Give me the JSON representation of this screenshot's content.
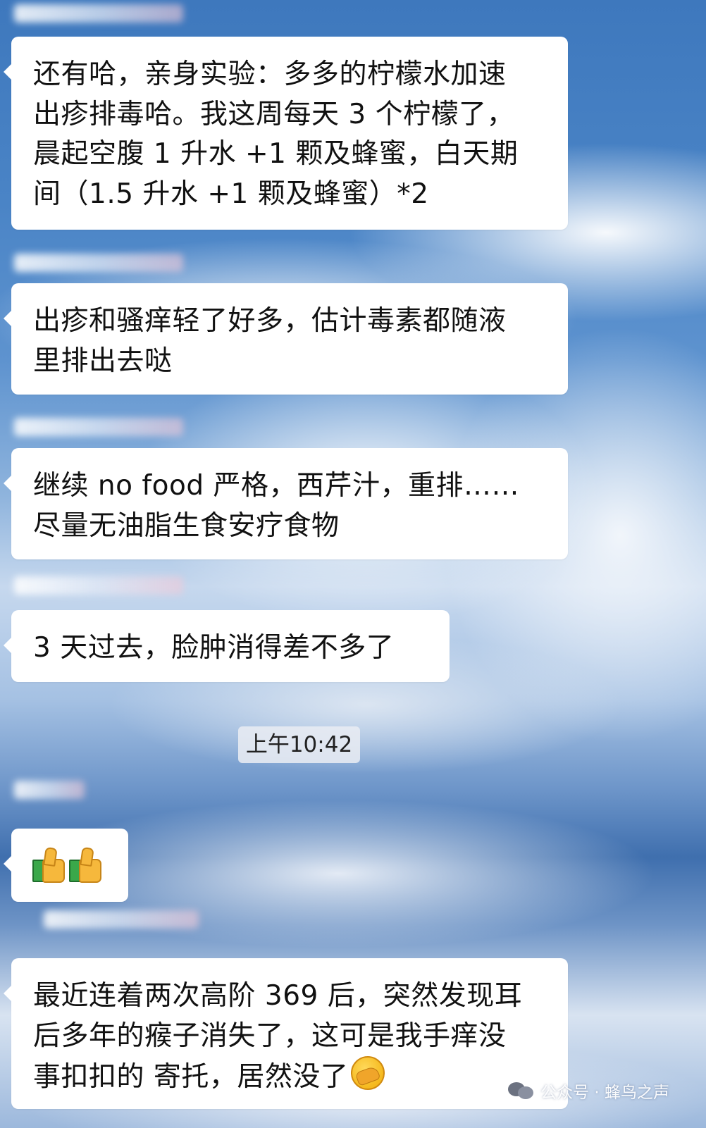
{
  "messages": [
    {
      "lines": [
        "还有哈，亲身实验：多多的柠檬水加速",
        "出疹排毒哈。我这周每天 3 个柠檬了，",
        "晨起空腹 1 升水 +1 颗及蜂蜜，白天期",
        "间（1.5 升水 +1 颗及蜂蜜）*2"
      ]
    },
    {
      "lines": [
        "出疹和骚痒轻了好多，估计毒素都随液",
        "里排出去哒"
      ]
    },
    {
      "lines": [
        "继续 no food 严格，西芹汁，重排……",
        "尽量无油脂生食安疗食物"
      ]
    },
    {
      "lines": [
        "3 天过去，脸肿消得差不多了"
      ]
    },
    {
      "lines": [
        "最近连着两次高阶 369 后，突然发现耳",
        "后多年的瘊子消失了，这可是我手痒没",
        "事扣扣的 寄托，居然没了"
      ],
      "emoji": "facepalm"
    }
  ],
  "timestamp": "上午10:42",
  "thumbs_message": {
    "emojis": [
      "thumbs-up",
      "thumbs-up"
    ]
  },
  "watermark": {
    "text": "公众号 · 蜂鸟之声",
    "icon": "wechat-icon"
  }
}
